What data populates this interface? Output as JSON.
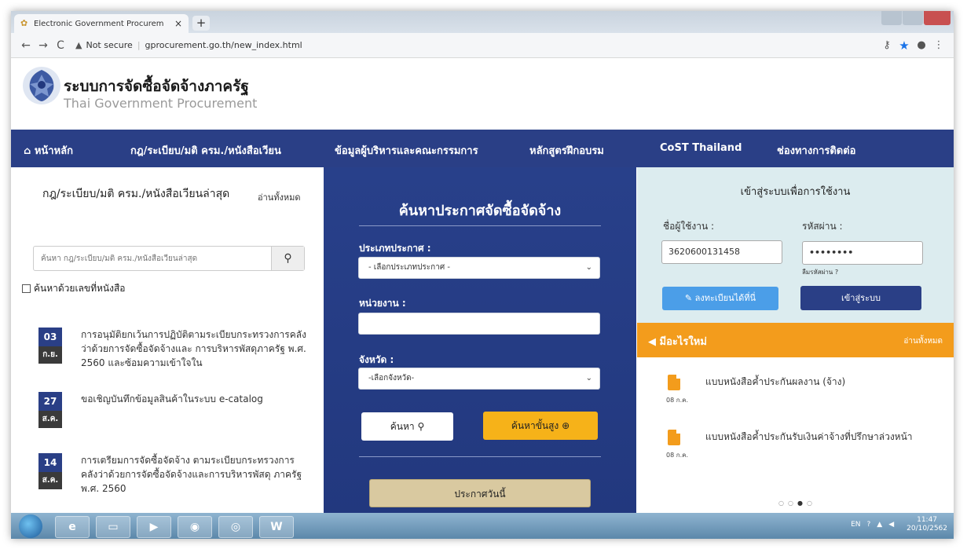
{
  "browser": {
    "tab_title": "Electronic Government Procurem",
    "tab_close": "×",
    "new_tab": "+",
    "back": "←",
    "forward": "→",
    "reload": "C",
    "security_icon": "▲",
    "security_label": "Not secure",
    "url": "gprocurement.go.th/new_index.html"
  },
  "header": {
    "title": "ระบบการจัดซื้อจัดจ้างภาครัฐ",
    "subtitle": "Thai Government Procurement"
  },
  "nav": {
    "items": [
      {
        "label": "หน้าหลัก",
        "icon": "home-icon"
      },
      {
        "label": "กฎ/ระเบียบ/มติ ครม./หนังสือเวียน"
      },
      {
        "label": "ข้อมูลผู้บริหารและคณะกรรมการ"
      },
      {
        "label": "หลักสูตรฝึกอบรม"
      },
      {
        "label": "CoST Thailand"
      },
      {
        "label": "ช่องทางการติดต่อ"
      }
    ]
  },
  "left": {
    "heading": "กฎ/ระเบียบ/มติ ครม./หนังสือเวียนล่าสุด",
    "read_all": "อ่านทั้งหมด",
    "search_placeholder": "ค้นหา กฎ/ระเบียบ/มติ ครม./หนังสือเวียนล่าสุด",
    "check_label": "ค้นหาด้วยเลขที่หนังสือ",
    "news": [
      {
        "day": "03",
        "month": "ก.ย.",
        "text": "การอนุมัติยกเว้นการปฏิบัติตามระเบียบกระทรวงการคลังว่าด้วยการจัดซื้อจัดจ้างและ การบริหารพัสดุภาครัฐ พ.ศ. 2560 และซ้อมความเข้าใจใน"
      },
      {
        "day": "27",
        "month": "ส.ค.",
        "text": "ขอเชิญบันทึกข้อมูลสินค้าในระบบ e-catalog"
      },
      {
        "day": "14",
        "month": "ส.ค.",
        "text": "การเตรียมการจัดซื้อจัดจ้าง ตามระเบียบกระทรวงการคลังว่าด้วยการจัดซื้อจัดจ้างและการบริหารพัสดุ ภาครัฐ พ.ศ. 2560"
      }
    ]
  },
  "center": {
    "title": "ค้นหาประกาศจัดซื้อจัดจ้าง",
    "type_label": "ประเภทประกาศ :",
    "type_value": "- เลือกประเภทประกาศ -",
    "agency_label": "หน่วยงาน :",
    "agency_value": "",
    "province_label": "จังหวัด :",
    "province_value": "-เลือกจังหวัด-",
    "search_btn": "ค้นหา",
    "adv_btn": "ค้นหาขั้นสูง",
    "today_btn": "ประกาศวันนี้"
  },
  "login": {
    "title": "เข้าสู่ระบบเพื่อการใช้งาน",
    "user_label": "ชื่อผู้ใช้งาน :",
    "user_value": "3620600131458",
    "pass_label": "รหัสผ่าน :",
    "pass_value": "••••••••",
    "forgot": "ลืมรหัสผ่าน ?",
    "register_btn": "ลงทะเบียนได้ที่นี่",
    "login_btn": "เข้าสู่ระบบ"
  },
  "whatsnew": {
    "title": "มีอะไรใหม่",
    "read_all": "อ่านทั้งหมด",
    "items": [
      {
        "date": "08 ก.ค.",
        "text": "แบบหนังสือค้ำประกันผลงาน (จ้าง)"
      },
      {
        "date": "08 ก.ค.",
        "text": "แบบหนังสือค้ำประกันรับเงินค่าจ้างที่ปรึกษาล่วงหน้า"
      }
    ]
  },
  "taskbar": {
    "lang": "EN",
    "time": "11:47",
    "date": "20/10/2562"
  }
}
